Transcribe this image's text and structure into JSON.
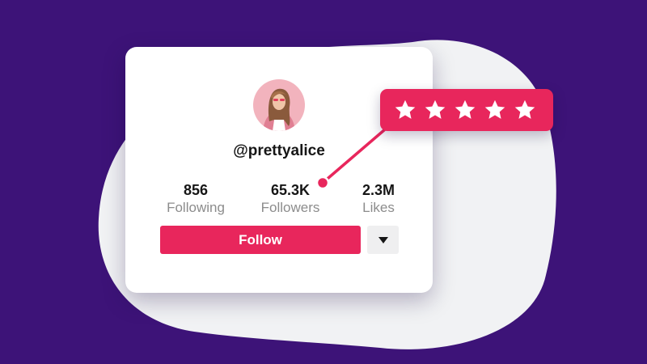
{
  "profile": {
    "username": "@prettyalice",
    "avatar_icon": "profile-photo"
  },
  "stats": [
    {
      "value": "856",
      "label": "Following"
    },
    {
      "value": "65.3K",
      "label": "Followers"
    },
    {
      "value": "2.3M",
      "label": "Likes"
    }
  ],
  "actions": {
    "follow_label": "Follow",
    "more_icon": "caret-down-icon"
  },
  "rating": {
    "stars": 5,
    "max": 5,
    "icon": "star-icon"
  },
  "colors": {
    "background": "#3d1378",
    "blob": "#f1f2f4",
    "accent": "#e8265c",
    "card": "#ffffff"
  }
}
